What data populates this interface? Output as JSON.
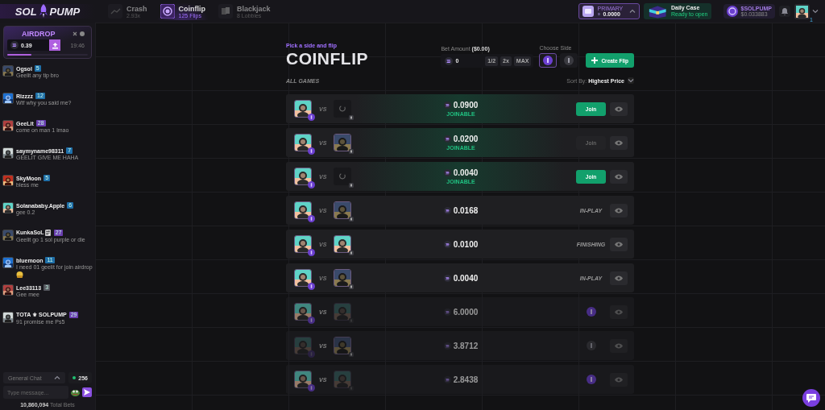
{
  "header": {
    "logo_left": "SOL",
    "logo_right": "PUMP",
    "tabs": [
      {
        "label": "Crash",
        "sub": "2.93x",
        "selected": false
      },
      {
        "label": "Coinflip",
        "sub": "125 Flips",
        "selected": true
      },
      {
        "label": "Blackjack",
        "sub": "8 Lobbies",
        "selected": false
      }
    ],
    "wallet": {
      "label": "PRIMARY",
      "value": "0.0000"
    },
    "daily_case": {
      "title": "Daily Case",
      "sub": "Ready to open"
    },
    "token": {
      "name": "$SOLPUMP",
      "price": "$0.033883"
    },
    "profile": {
      "level": "1"
    }
  },
  "airdrop": {
    "title": "AIRDROP",
    "value": "0.39",
    "timer": "19:46",
    "level": 0.3
  },
  "chat": {
    "messages": [
      {
        "user": "Ogsol",
        "level": "5",
        "color": "#1f6fa8",
        "text": "Geelit any tip bro",
        "emoji": false
      },
      {
        "user": "Rizzzz",
        "level": "12",
        "color": "#1f6fa8",
        "text": "Wtf why you said me?",
        "emoji": false
      },
      {
        "user": "GeeLit",
        "level": "28",
        "color": "#6b3fb0",
        "text": "come on man 1 lmao",
        "emoji": false
      },
      {
        "user": "saymyname98311",
        "level": "7",
        "color": "#1f6fa8",
        "text": "GEELIT GIVE ME HAHA",
        "emoji": false
      },
      {
        "user": "SkyMoon",
        "level": "5",
        "color": "#1f6fa8",
        "text": "bless me",
        "emoji": false
      },
      {
        "user": "Solanababy.Apple",
        "level": "6",
        "color": "#1f6fa8",
        "text": "gee 0.2",
        "emoji": false
      },
      {
        "user": "KunkaSoL🗒",
        "level": "27",
        "color": "#6b3fb0",
        "text": "Geelit go 1 sol purple or die",
        "emoji": false
      },
      {
        "user": "bluemoon",
        "level": "11",
        "color": "#1f6fa8",
        "text": "I need 01 geelit for join airdrop",
        "emoji": true
      },
      {
        "user": "Lee33113",
        "level": "3",
        "color": "#55575e",
        "text": "Gee mee",
        "emoji": false
      },
      {
        "user": "TOTA ⚜ SOLPUMP",
        "level": "29",
        "color": "#6b3fb0",
        "text": "91 promise me Ps5",
        "emoji": false
      }
    ],
    "channel": "General Chat",
    "online": "256",
    "placeholder": "Type message...",
    "total": "10,860,094",
    "total_label": "Total Bets"
  },
  "coinflip": {
    "kicker": "Pick a side and flip",
    "title": "COINFLIP",
    "bet_label": "Bet Amount **($0.00)**",
    "bet_value": "0",
    "bet_buttons": [
      "1/2",
      "2x",
      "MAX"
    ],
    "side_label": "Choose Side",
    "sides": [
      {
        "kind": "purple",
        "selected": true
      },
      {
        "kind": "silver",
        "selected": false
      }
    ],
    "create": "Create Flip",
    "section": "ALL GAMES",
    "sort_label": "Sort By:",
    "sort_value": "Highest Price"
  },
  "games": [
    {
      "kind": "joinable",
      "vs": "VS",
      "amount": "0.0900",
      "status": "JOINABLE",
      "join": "Join",
      "join_enabled": true,
      "faded": false,
      "opponent_joined": false
    },
    {
      "kind": "joinable",
      "vs": "VS",
      "amount": "0.0200",
      "status": "JOINABLE",
      "join": "Join",
      "join_enabled": false,
      "faded": false,
      "opponent_joined": true
    },
    {
      "kind": "joinable",
      "vs": "VS",
      "amount": "0.0040",
      "status": "JOINABLE",
      "join": "Join",
      "join_enabled": true,
      "faded": false,
      "opponent_joined": false
    },
    {
      "kind": "progress",
      "vs": "VS",
      "amount": "0.0168",
      "status": "IN-PLAY",
      "faded": false,
      "opponent_joined": true
    },
    {
      "kind": "progress",
      "vs": "VS",
      "amount": "0.0100",
      "status": "FINISHING",
      "faded": false,
      "opponent_joined": true
    },
    {
      "kind": "progress",
      "vs": "VS",
      "amount": "0.0040",
      "status": "IN-PLAY",
      "faded": false,
      "opponent_joined": true
    },
    {
      "kind": "ended",
      "vs": "VS",
      "amount": "6.0000",
      "creator_won": true,
      "faded": true,
      "opponent_joined": true
    },
    {
      "kind": "ended",
      "vs": "VS",
      "amount": "3.8712",
      "creator_won": false,
      "faded": true,
      "opponent_joined": true
    },
    {
      "kind": "ended",
      "vs": "VS",
      "amount": "2.8438",
      "creator_won": true,
      "faded": true,
      "opponent_joined": true
    }
  ]
}
